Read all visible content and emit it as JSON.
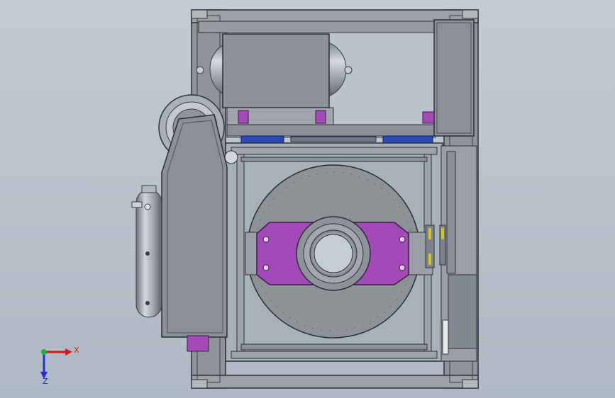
{
  "triad": {
    "x_label": "X",
    "z_label": "Z",
    "x_color": "#d21a1a",
    "y_color": "#19b23a",
    "z_color": "#2230d2"
  },
  "colors": {
    "background": "#b8c3cc",
    "frame": "#8a9095",
    "steel": "#9aa0a8",
    "plate": "#878c93",
    "magenta": "#a449b8",
    "blue_parts": "#2a48b8"
  }
}
